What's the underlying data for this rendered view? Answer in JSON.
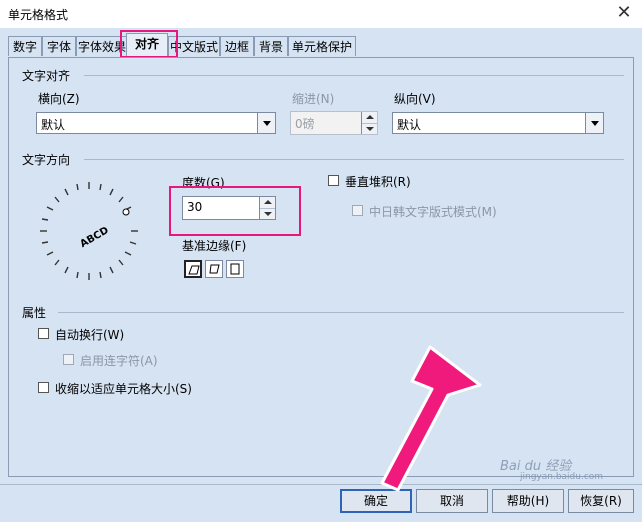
{
  "window": {
    "title": "单元格格式",
    "close_glyph": "✕"
  },
  "tabs": [
    {
      "label": "数字",
      "active": false
    },
    {
      "label": "字体",
      "active": false
    },
    {
      "label": "字体效果",
      "active": false
    },
    {
      "label": "对齐",
      "active": true
    },
    {
      "label": "中文版式",
      "active": false
    },
    {
      "label": "边框",
      "active": false
    },
    {
      "label": "背景",
      "active": false
    },
    {
      "label": "单元格保护",
      "active": false
    }
  ],
  "text_alignment": {
    "section_title": "文字对齐",
    "horizontal": {
      "label": "横向(Z)",
      "value": "默认"
    },
    "indent": {
      "label": "缩进(N)",
      "value": "0磅"
    },
    "vertical": {
      "label": "纵向(V)",
      "value": "默认"
    }
  },
  "text_direction": {
    "section_title": "文字方向",
    "dial_text": "ABCD",
    "degrees": {
      "label": "度数(G)",
      "value": "30"
    },
    "reference_edge_label": "基准边缘(F)",
    "stacked_vertically": {
      "label": "垂直堆积(R)",
      "checked": false
    },
    "asian_layout": {
      "label": "中日韩文字版式模式(M)",
      "checked": false
    }
  },
  "properties": {
    "section_title": "属性",
    "wrap_text": {
      "label": "自动换行(W)",
      "checked": false
    },
    "hyphenation": {
      "label": "启用连字符(A)",
      "checked": false
    },
    "shrink_to_fit": {
      "label": "收缩以适应单元格大小(S)",
      "checked": false
    }
  },
  "buttons": {
    "ok": "确定",
    "cancel": "取消",
    "help": "帮助(H)",
    "reset": "恢复(R)"
  },
  "watermark": {
    "text": "Bai du 经验",
    "url": "jingyan.baidu.com"
  },
  "colors": {
    "highlight": "#e6187e",
    "dialog_bg": "#d6e3f3"
  }
}
